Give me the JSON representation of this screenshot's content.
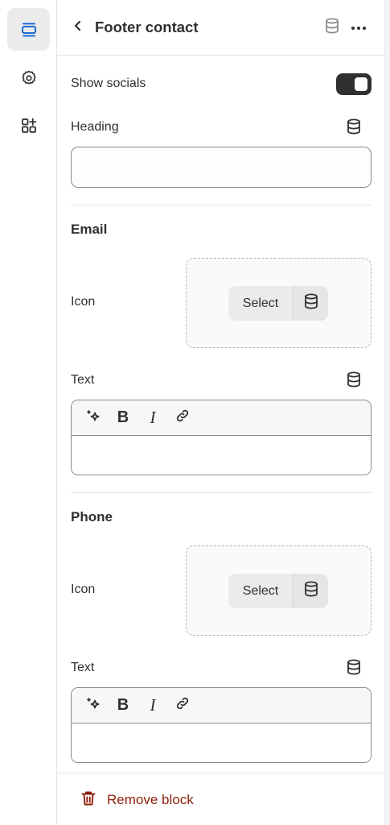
{
  "rail": {
    "items": [
      {
        "name": "sections",
        "icon": "sections-icon",
        "active": true
      },
      {
        "name": "settings",
        "icon": "gear-icon",
        "active": false
      },
      {
        "name": "apps",
        "icon": "apps-add-icon",
        "active": false
      }
    ]
  },
  "header": {
    "title": "Footer contact",
    "back_icon": "chevron-left-icon",
    "data_icon": "database-icon",
    "more_icon": "more-horizontal-icon"
  },
  "fields": {
    "show_socials": {
      "label": "Show socials",
      "checked": true
    },
    "heading": {
      "label": "Heading",
      "value": ""
    }
  },
  "email": {
    "title": "Email",
    "icon_label": "Icon",
    "select_label": "Select",
    "text_label": "Text",
    "text_value": ""
  },
  "phone": {
    "title": "Phone",
    "icon_label": "Icon",
    "select_label": "Select",
    "text_label": "Text",
    "text_value": ""
  },
  "toolbar": {
    "bold": "B",
    "italic": "I"
  },
  "footer": {
    "remove_label": "Remove block"
  },
  "colors": {
    "accent": "#005bd3",
    "text": "#303030",
    "critical": "#8e1f0b",
    "toggle_on": "#303030"
  }
}
